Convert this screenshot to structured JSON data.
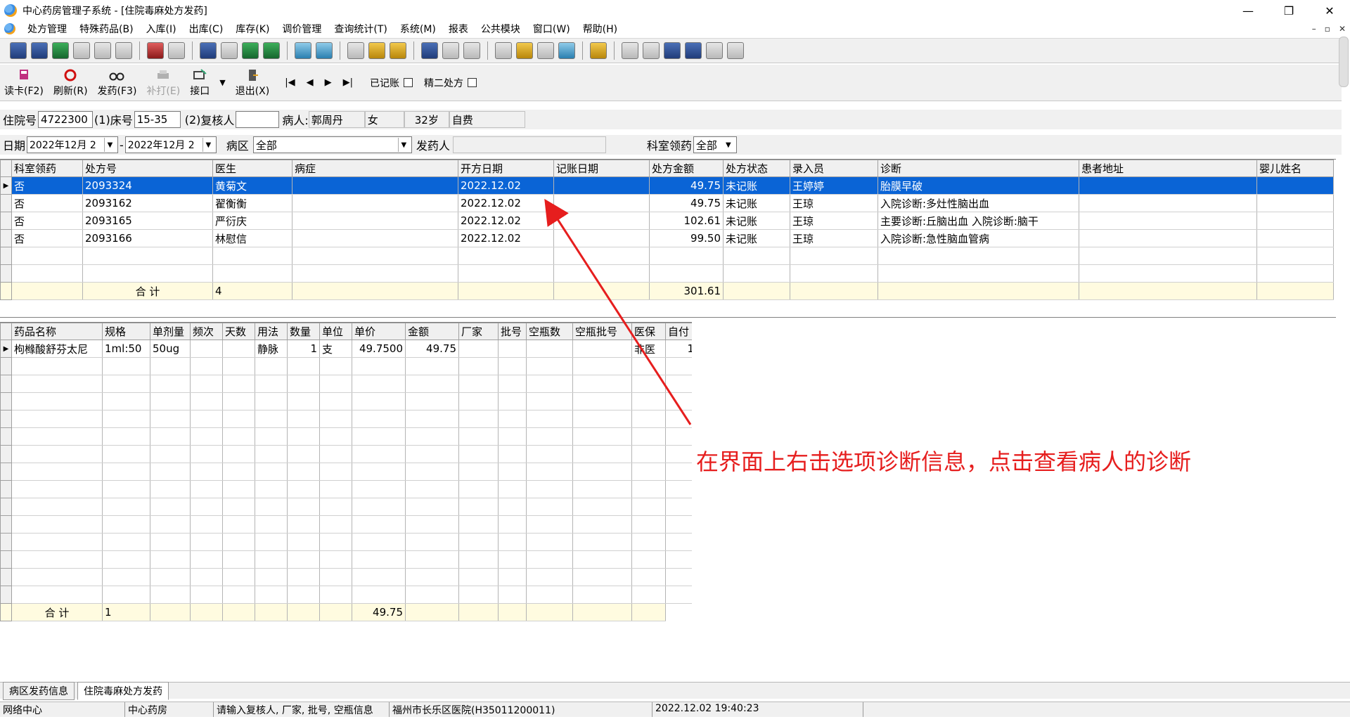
{
  "window": {
    "title": "中心药房管理子系统 - [住院毒麻处方发药]",
    "controls": [
      "—",
      "❐",
      "✕"
    ]
  },
  "menu": {
    "items": [
      "处方管理",
      "特殊药品(B)",
      "入库(I)",
      "出库(C)",
      "库存(K)",
      "调价管理",
      "查询统计(T)",
      "系统(M)",
      "报表",
      "公共模块",
      "窗口(W)",
      "帮助(H)"
    ],
    "mdi_controls": [
      "–",
      "▫",
      "✕"
    ]
  },
  "actions": {
    "read_card": "读卡(F2)",
    "refresh": "刷新(R)",
    "dispense": "发药(F3)",
    "reprint": "补打(E)",
    "interface": "接口",
    "exit": "退出(X)",
    "nav": [
      "|◀",
      "◀",
      "▶",
      "▶|"
    ],
    "booked_label": "已记账",
    "jing2_label": "精二处方"
  },
  "form": {
    "admission_label": "住院号",
    "admission_no": "4722300",
    "bed_prefix": "(1)",
    "bed_label": "床号",
    "bed_no": "15-35",
    "reviewer_prefix": "(2)",
    "reviewer_label": "复核人",
    "reviewer_value": "",
    "patient_label": "病人:",
    "patient_name": "郭周丹",
    "patient_sex": "女",
    "patient_age": "32岁",
    "patient_payment": "自费",
    "date_label": "日期",
    "date_from": "2022年12月 2",
    "date_sep": "-",
    "date_to": "2022年12月 2",
    "ward_label": "病区",
    "ward_value": "全部",
    "dispenser_label": "发药人",
    "dispenser_value": "",
    "dept_label": "科室领药",
    "dept_value": "全部"
  },
  "prescriptions": {
    "columns": [
      "科室领药",
      "处方号",
      "医生",
      "病症",
      "开方日期",
      "记账日期",
      "处方金额",
      "处方状态",
      "录入员",
      "诊断",
      "患者地址",
      "婴儿姓名"
    ],
    "rows": [
      [
        "否",
        "2093324",
        "黄菊文",
        "",
        "2022.12.02",
        "",
        "49.75",
        "未记账",
        "王婷婷",
        "胎膜早破",
        "",
        ""
      ],
      [
        "否",
        "2093162",
        "翟衡衡",
        "",
        "2022.12.02",
        "",
        "49.75",
        "未记账",
        "王琼",
        "入院诊断:多灶性脑出血",
        "",
        ""
      ],
      [
        "否",
        "2093165",
        "严衍庆",
        "",
        "2022.12.02",
        "",
        "102.61",
        "未记账",
        "王琼",
        "主要诊断:丘脑出血 入院诊断:脑干",
        "",
        ""
      ],
      [
        "否",
        "2093166",
        "林慰信",
        "",
        "2022.12.02",
        "",
        "99.50",
        "未记账",
        "王琼",
        "入院诊断:急性脑血管病",
        "",
        ""
      ]
    ],
    "total_label": "合  计",
    "total_count": "4",
    "total_amount": "301.61"
  },
  "drugs": {
    "columns": [
      "药品名称",
      "规格",
      "单剂量",
      "频次",
      "天数",
      "用法",
      "数量",
      "单位",
      "单价",
      "金额",
      "厂家",
      "批号",
      "空瓶数",
      "空瓶批号",
      "医保",
      "自付"
    ],
    "rows": [
      [
        "枸橼酸舒芬太尼",
        "1ml:50",
        "50ug",
        "",
        "",
        "静脉",
        "1",
        "支",
        "49.7500",
        "49.75",
        "",
        "",
        "",
        "",
        "非医",
        "1"
      ]
    ],
    "total_label": "合  计",
    "total_count": "1",
    "total_amount": "49.75"
  },
  "tabs": [
    "病区发药信息",
    "住院毒麻处方发药"
  ],
  "status": {
    "center": "网络中心",
    "pharmacy": "中心药房",
    "hint": "请输入复核人, 厂家, 批号, 空瓶信息",
    "hospital": "福州市长乐区医院(H35011200011)",
    "datetime": "2022.12.02 19:40:23"
  },
  "annotation": {
    "text": "在界面上右击选项诊断信息，点击查看病人的诊断",
    "color": "#e61e1e"
  }
}
